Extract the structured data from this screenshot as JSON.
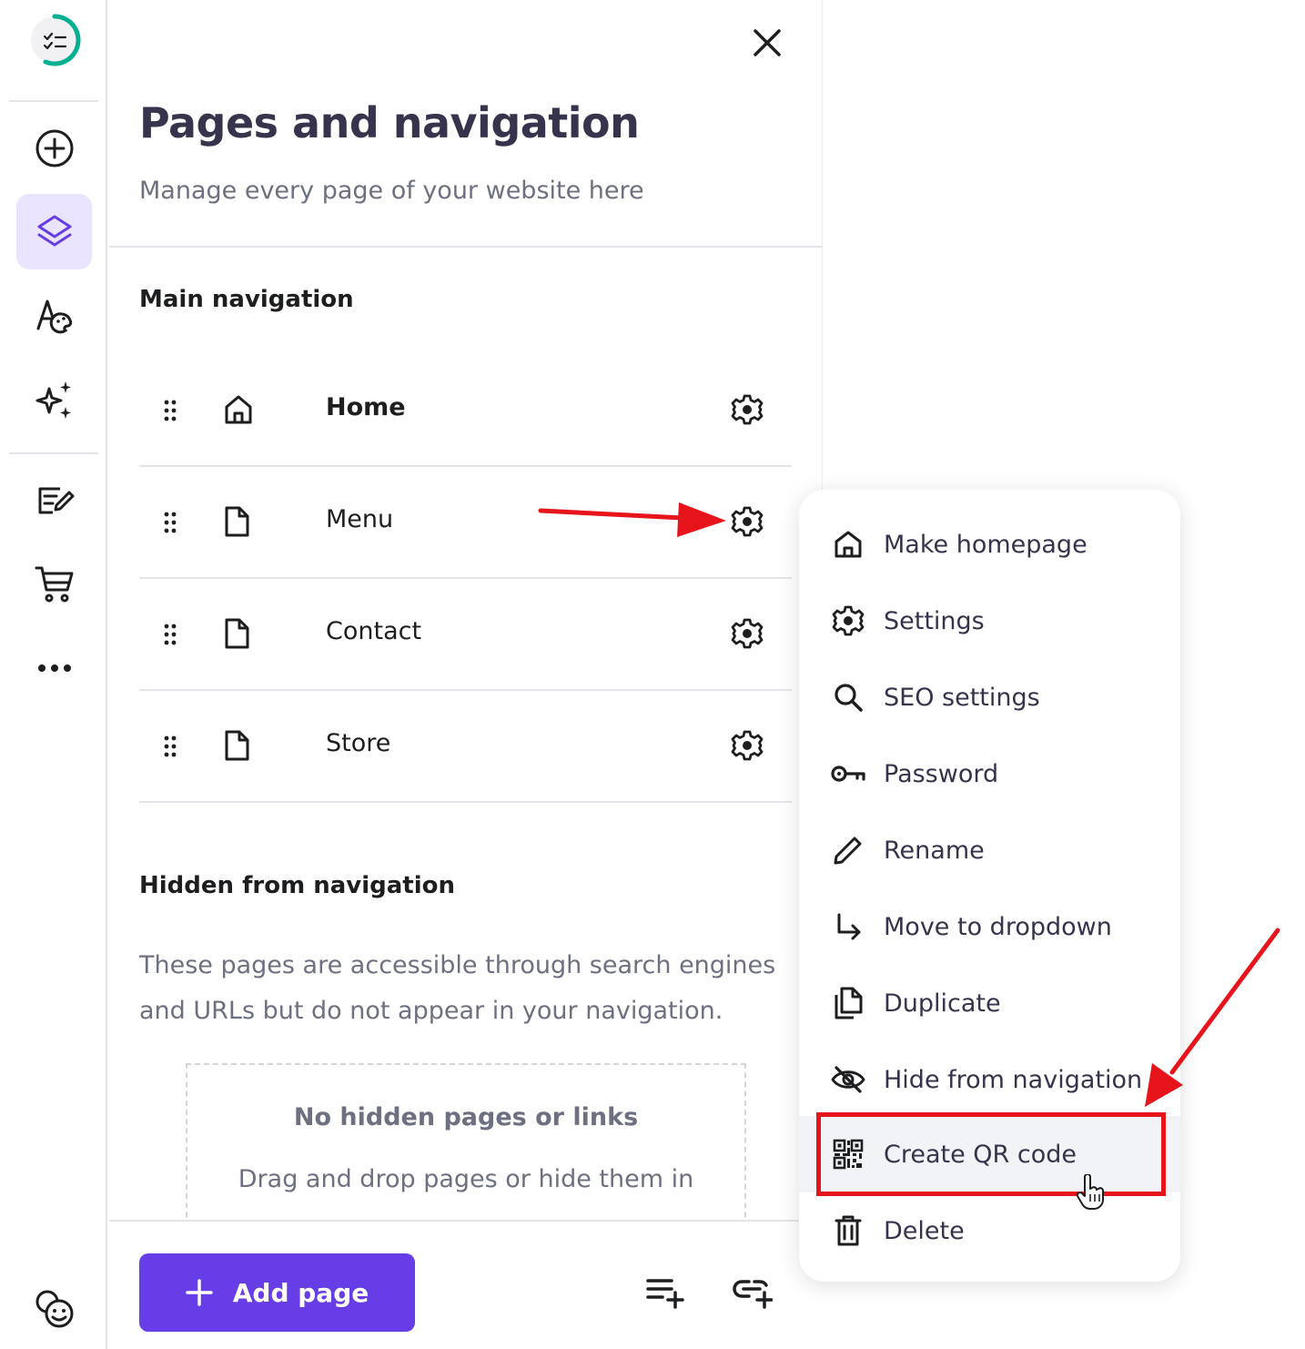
{
  "panel": {
    "title": "Pages and navigation",
    "subtitle": "Manage every page of your website here"
  },
  "main_navigation": {
    "title": "Main navigation",
    "pages": [
      {
        "label": "Home",
        "icon": "home-icon",
        "bold": true
      },
      {
        "label": "Menu",
        "icon": "page-icon",
        "bold": false
      },
      {
        "label": "Contact",
        "icon": "page-icon",
        "bold": false
      },
      {
        "label": "Store",
        "icon": "page-icon",
        "bold": false
      }
    ]
  },
  "hidden_navigation": {
    "title": "Hidden from navigation",
    "description": "These pages are accessible through search engines and URLs but do not appear in your navigation.",
    "empty_title": "No hidden pages or links",
    "empty_text": "Drag and drop pages or hide them in"
  },
  "footer": {
    "add_page_label": "Add page"
  },
  "context_menu": {
    "items": [
      {
        "label": "Make homepage",
        "icon": "home-icon"
      },
      {
        "label": "Settings",
        "icon": "gear-icon"
      },
      {
        "label": "SEO settings",
        "icon": "search-icon"
      },
      {
        "label": "Password",
        "icon": "key-icon"
      },
      {
        "label": "Rename",
        "icon": "pencil-icon"
      },
      {
        "label": "Move to dropdown",
        "icon": "arrow-down-right-icon"
      },
      {
        "label": "Duplicate",
        "icon": "duplicate-icon"
      },
      {
        "label": "Hide from navigation",
        "icon": "eye-off-icon"
      },
      {
        "label": "Create QR code",
        "icon": "qr-code-icon"
      },
      {
        "label": "Delete",
        "icon": "trash-icon"
      }
    ]
  },
  "colors": {
    "accent": "#673de6",
    "active_rail": "#ebe4ff",
    "annotation_red": "#e8141b",
    "logo_green": "#00b090"
  }
}
